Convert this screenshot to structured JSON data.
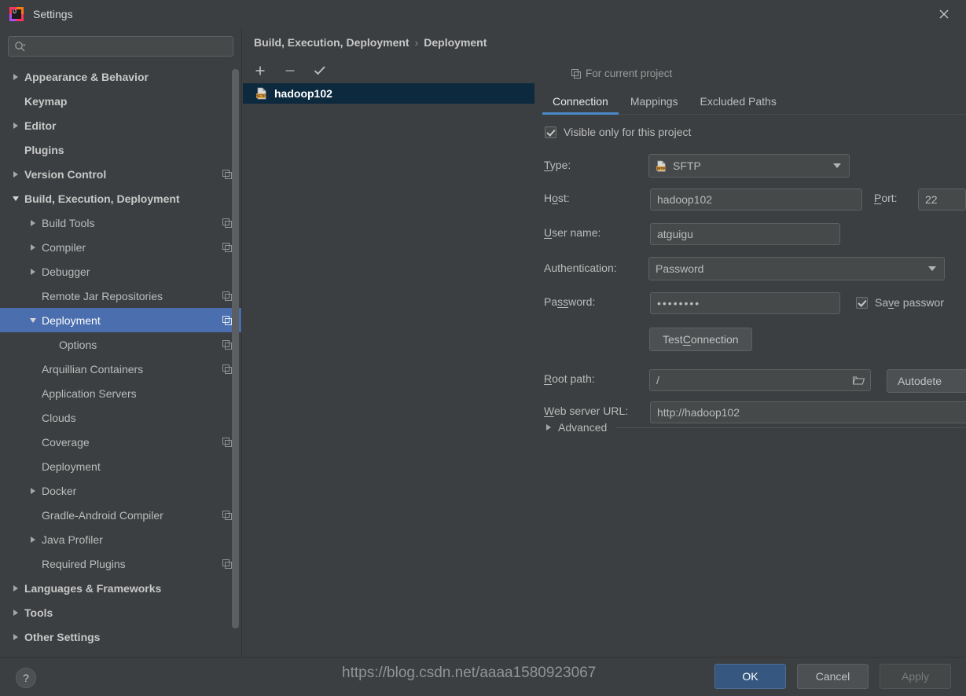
{
  "window": {
    "title": "Settings",
    "logo_icon": "intellij-idea-logo",
    "close_icon": "close-icon"
  },
  "search": {
    "value": "",
    "placeholder": "",
    "icon": "search-icon"
  },
  "sidebar": {
    "items": [
      {
        "label": "Appearance & Behavior",
        "indent": 0,
        "arrow": "right",
        "bold": true,
        "copy": false,
        "selected": false
      },
      {
        "label": "Keymap",
        "indent": 0,
        "arrow": "none",
        "bold": true,
        "copy": false,
        "selected": false
      },
      {
        "label": "Editor",
        "indent": 0,
        "arrow": "right",
        "bold": true,
        "copy": false,
        "selected": false
      },
      {
        "label": "Plugins",
        "indent": 0,
        "arrow": "none",
        "bold": true,
        "copy": false,
        "selected": false
      },
      {
        "label": "Version Control",
        "indent": 0,
        "arrow": "right",
        "bold": true,
        "copy": true,
        "selected": false
      },
      {
        "label": "Build, Execution, Deployment",
        "indent": 0,
        "arrow": "down",
        "bold": true,
        "copy": false,
        "selected": false
      },
      {
        "label": "Build Tools",
        "indent": 1,
        "arrow": "right",
        "bold": false,
        "copy": true,
        "selected": false
      },
      {
        "label": "Compiler",
        "indent": 1,
        "arrow": "right",
        "bold": false,
        "copy": true,
        "selected": false
      },
      {
        "label": "Debugger",
        "indent": 1,
        "arrow": "right",
        "bold": false,
        "copy": false,
        "selected": false
      },
      {
        "label": "Remote Jar Repositories",
        "indent": 1,
        "arrow": "none",
        "bold": false,
        "copy": true,
        "selected": false
      },
      {
        "label": "Deployment",
        "indent": 1,
        "arrow": "down",
        "bold": false,
        "copy": true,
        "selected": true
      },
      {
        "label": "Options",
        "indent": 2,
        "arrow": "none",
        "bold": false,
        "copy": true,
        "selected": false
      },
      {
        "label": "Arquillian Containers",
        "indent": 1,
        "arrow": "none",
        "bold": false,
        "copy": true,
        "selected": false
      },
      {
        "label": "Application Servers",
        "indent": 1,
        "arrow": "none",
        "bold": false,
        "copy": false,
        "selected": false
      },
      {
        "label": "Clouds",
        "indent": 1,
        "arrow": "none",
        "bold": false,
        "copy": false,
        "selected": false
      },
      {
        "label": "Coverage",
        "indent": 1,
        "arrow": "none",
        "bold": false,
        "copy": true,
        "selected": false
      },
      {
        "label": "Deployment",
        "indent": 1,
        "arrow": "none",
        "bold": false,
        "copy": false,
        "selected": false
      },
      {
        "label": "Docker",
        "indent": 1,
        "arrow": "right",
        "bold": false,
        "copy": false,
        "selected": false
      },
      {
        "label": "Gradle-Android Compiler",
        "indent": 1,
        "arrow": "none",
        "bold": false,
        "copy": true,
        "selected": false
      },
      {
        "label": "Java Profiler",
        "indent": 1,
        "arrow": "right",
        "bold": false,
        "copy": false,
        "selected": false
      },
      {
        "label": "Required Plugins",
        "indent": 1,
        "arrow": "none",
        "bold": false,
        "copy": true,
        "selected": false
      },
      {
        "label": "Languages & Frameworks",
        "indent": 0,
        "arrow": "right",
        "bold": true,
        "copy": false,
        "selected": false
      },
      {
        "label": "Tools",
        "indent": 0,
        "arrow": "right",
        "bold": true,
        "copy": false,
        "selected": false
      },
      {
        "label": "Other Settings",
        "indent": 0,
        "arrow": "right",
        "bold": true,
        "copy": false,
        "selected": false
      }
    ]
  },
  "breadcrumb": {
    "parent": "Build, Execution, Deployment",
    "separator": "›",
    "current": "Deployment"
  },
  "server_toolbar": {
    "add_icon": "plus-icon",
    "remove_icon": "minus-icon",
    "default_icon": "check-icon"
  },
  "server_list": {
    "items": [
      {
        "name": "hadoop102",
        "icon": "sftp-server-icon",
        "selected": true
      }
    ]
  },
  "detail": {
    "scope_note": "For current project",
    "scope_icon": "copy-icon",
    "tabs": [
      {
        "label": "Connection",
        "active": true
      },
      {
        "label": "Mappings",
        "active": false
      },
      {
        "label": "Excluded Paths",
        "active": false
      }
    ],
    "visible_only": {
      "label": "Visible only for this project",
      "checked": true
    },
    "fields": {
      "type_label_pre": "",
      "type_label_mnemonic": "T",
      "type_label_post": "ype:",
      "type_value": "SFTP",
      "type_icon": "sftp-type-icon",
      "host_label_pre": "H",
      "host_label_mnemonic": "o",
      "host_label_post": "st:",
      "host_value": "hadoop102",
      "port_label_mnemonic": "P",
      "port_label_post": "ort:",
      "port_value": "22",
      "user_label_mnemonic": "U",
      "user_label_post": "ser name:",
      "user_value": "atguigu",
      "auth_label": "Authentication:",
      "auth_value": "Password",
      "password_label_pre": "Pa",
      "password_label_mnemonic": "ss",
      "password_label_post": "word:",
      "password_value": "••••••••",
      "save_password_pre": "Sa",
      "save_password_mnemonic": "v",
      "save_password_post": "e passwor",
      "save_password_checked": true,
      "test_connection_pre": "Test ",
      "test_connection_mnemonic": "C",
      "test_connection_post": "onnection",
      "rootpath_label_mnemonic": "R",
      "rootpath_label_post": "oot path:",
      "rootpath_value": "/",
      "rootpath_browse_icon": "folder-icon",
      "autodetect_label": "Autodete",
      "weburl_label_mnemonic": "W",
      "weburl_label_post": "eb server URL:",
      "weburl_value": "http://hadoop102"
    },
    "advanced": {
      "label": "Advanced",
      "expanded": false
    }
  },
  "footer": {
    "help_label": "?",
    "ok_label": "OK",
    "cancel_label": "Cancel",
    "apply_label": "Apply"
  },
  "watermark": {
    "text": "https://blog.csdn.net/aaaa1580923067"
  },
  "colors": {
    "background": "#3c3f41",
    "selection_blue": "#4b6eaf",
    "list_selection": "#0d293e",
    "tab_accent": "#4a88c7",
    "primary_button": "#365880",
    "text": "#bbbbbb"
  }
}
